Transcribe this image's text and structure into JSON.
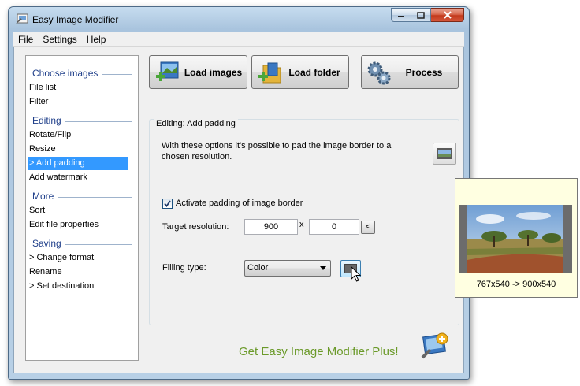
{
  "window": {
    "title": "Easy Image Modifier"
  },
  "menu": {
    "items": [
      "File",
      "Settings",
      "Help"
    ]
  },
  "sidebar": {
    "sections": [
      {
        "header": "Choose images",
        "items": [
          "File list",
          "Filter"
        ]
      },
      {
        "header": "Editing",
        "items": [
          "Rotate/Flip",
          "Resize",
          "> Add padding",
          "Add watermark"
        ]
      },
      {
        "header": "More",
        "items": [
          "Sort",
          "Edit file properties"
        ]
      },
      {
        "header": "Saving",
        "items": [
          "> Change format",
          "Rename",
          "> Set destination"
        ]
      }
    ],
    "selected_item": "> Add padding"
  },
  "toolbar": {
    "load_images": "Load images",
    "load_folder": "Load folder",
    "process": "Process"
  },
  "panel": {
    "title": "Editing: Add padding",
    "description": "With these options it's possible to pad the image border to a chosen resolution.",
    "activate_label": "Activate padding of image border",
    "activate_checked": true,
    "target_label": "Target resolution:",
    "target_width": "900",
    "x_separator": "x",
    "target_height": "0",
    "small_button_label": "<",
    "filling_label": "Filling type:",
    "filling_value": "Color",
    "fill_color": "#666666"
  },
  "promo": {
    "text": "Get Easy Image Modifier Plus!"
  },
  "preview": {
    "caption": "767x540 -> 900x540"
  },
  "colors": {
    "accent_selected": "#3399ff",
    "section_header": "#1f3f8a",
    "promo_green": "#6b9a2a"
  }
}
